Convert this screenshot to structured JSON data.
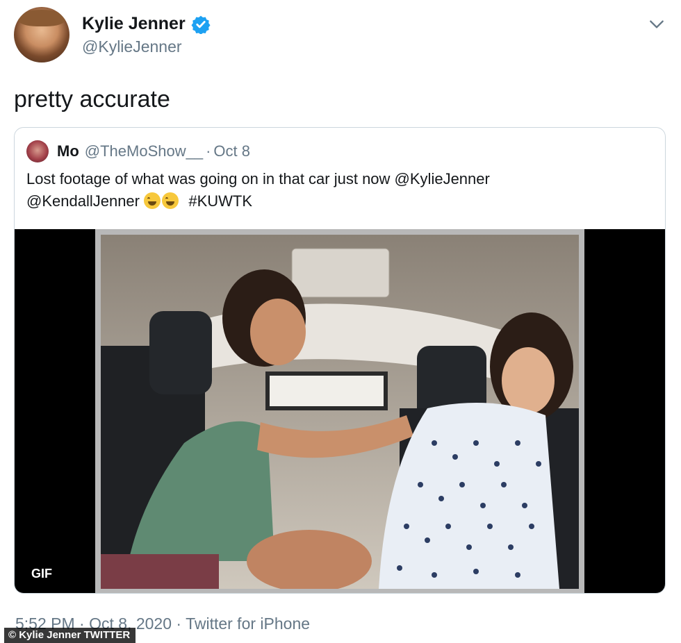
{
  "tweet": {
    "author_name": "Kylie Jenner",
    "author_handle": "@KylieJenner",
    "text": "pretty accurate",
    "verified": true,
    "timestamp": "5:52 PM · Oct 8, 2020",
    "source": "Twitter for iPhone",
    "separator": "·"
  },
  "quoted_tweet": {
    "author_name": "Mo",
    "author_handle": "@TheMoShow__",
    "separator": "·",
    "date": "Oct 8",
    "text_line1": "Lost footage of what was going on in that car just now @KylieJenner",
    "text_line2_mention": "@KendallJenner",
    "text_line2_hashtag": "#KUWTK",
    "media_badge": "GIF"
  },
  "credit": "© Kylie Jenner TWITTER",
  "icons": {
    "verified": "verified-badge-icon",
    "menu": "chevron-down-icon",
    "emoji": "tears-of-joy-emoji"
  },
  "colors": {
    "verified_blue": "#1da1f2",
    "secondary_text": "#657786",
    "border": "#ccd6dd"
  }
}
